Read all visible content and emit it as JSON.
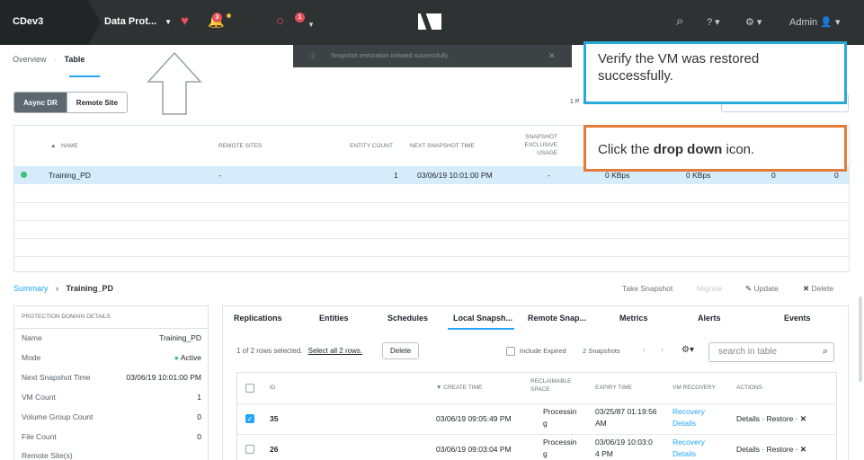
{
  "topbar": {
    "cluster": "CDev3",
    "section": "Data Prot...",
    "alerts_count": "3",
    "tasks_count": "1",
    "user": "Admin",
    "help": "?"
  },
  "toast": {
    "message": "Snapshot restoration initiated successfully."
  },
  "view_tabs": {
    "overview": "Overview",
    "table": "Table"
  },
  "mode_buttons": [
    "Async DR",
    "Remote Site"
  ],
  "pagination_label": "1 P",
  "callouts": {
    "blue": "Verify the VM was restored successfully.",
    "orange_prefix": "Click the ",
    "orange_bold": "drop down",
    "orange_suffix": " icon."
  },
  "main_table": {
    "headers": {
      "name": "NAME",
      "remote_sites": "REMOTE SITES",
      "entity_count": "ENTITY COUNT",
      "next_snapshot": "NEXT SNAPSHOT TIME",
      "snapshot_usage": "SNAPSHOT EXCLUSIVE USAGE"
    },
    "row": {
      "name": "Training_PD",
      "remote_sites": "-",
      "entity_count": "1",
      "next_snapshot": "03/06/19 10:01:00 PM",
      "usage": "-",
      "tx": "0 KBps",
      "rx": "0 KBps",
      "c1": "0",
      "c2": "0"
    }
  },
  "summary": {
    "link": "Summary",
    "separator": "›",
    "name": "Training_PD",
    "actions": [
      "Take Snapshot",
      "Migrate",
      "Update",
      "Delete"
    ]
  },
  "left_panel": {
    "title": "PROTECTION DOMAIN DETAILS",
    "rows": [
      {
        "label": "Name",
        "value": "Training_PD"
      },
      {
        "label": "Mode",
        "value": "Active"
      },
      {
        "label": "Next Snapshot Time",
        "value": "03/06/19 10:01:00 PM"
      },
      {
        "label": "VM Count",
        "value": "1"
      },
      {
        "label": "Volume Group Count",
        "value": "0"
      },
      {
        "label": "File Count",
        "value": "0"
      },
      {
        "label": "Remote Site(s)",
        "value": ""
      }
    ]
  },
  "right_tabs": [
    "Replications",
    "Entities",
    "Schedules",
    "Local Snapsh...",
    "Remote Snap...",
    "Metrics",
    "Alerts",
    "Events"
  ],
  "snapshots": {
    "selected_text": "1 of 2 rows selected.",
    "select_all": "Select all 2 rows.",
    "delete": "Delete",
    "include_expired": "Include Expired",
    "count": "2 Snapshots",
    "search_placeholder": "search in table",
    "headers": {
      "id": "ID",
      "create_time": "CREATE TIME",
      "reclaimable": "RECLAIMABLE SPACE",
      "expiry": "EXPIRY TIME",
      "vm_recovery": "VM RECOVERY",
      "actions": "ACTIONS"
    },
    "rows": [
      {
        "id": "35",
        "create_time": "03/06/19 09:05:49 PM",
        "reclaim1": "Processin",
        "reclaim2": "g",
        "expiry1": "03/25/87 01:19:56",
        "expiry2": "AM",
        "rec1": "Recovery",
        "rec2": "Details",
        "details": "Details",
        "restore": "Restore"
      },
      {
        "id": "26",
        "create_time": "03/06/19 09:03:04 PM",
        "reclaim1": "Processin",
        "reclaim2": "g",
        "expiry1": "03/06/19 10:03:0",
        "expiry2": "4 PM",
        "rec1": "Recovery",
        "rec2": "Details",
        "details": "Details",
        "restore": "Restore"
      }
    ]
  }
}
